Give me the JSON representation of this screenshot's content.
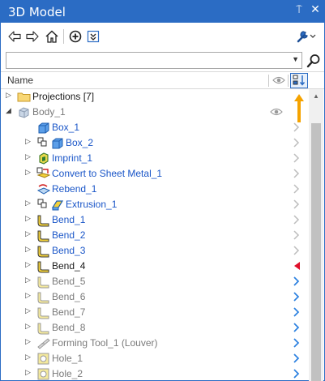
{
  "window": {
    "title": "3D Model",
    "pin_glyph": "⍑",
    "close_glyph": "✕"
  },
  "toolbar": {
    "buttons": [
      "back-arrow-icon",
      "forward-arrow-icon",
      "home-icon",
      "add-view-icon",
      "expand-icon",
      "settings-wrench-icon"
    ]
  },
  "search": {
    "value": "",
    "placeholder": ""
  },
  "header": {
    "name_label": "Name"
  },
  "tree": [
    {
      "label": "Projections [7]",
      "style": "dark",
      "indent": 0,
      "expander": "▷",
      "icon": "folder-icon",
      "mark": "none"
    },
    {
      "label": "Body_1",
      "style": "gray",
      "indent": 0,
      "expander": "◢",
      "icon": "body-icon",
      "mark": "eye"
    },
    {
      "label": "Box_1",
      "style": "blue",
      "indent": 1,
      "expander": "",
      "icon": "box-feature-icon",
      "mark": "chevron-gray"
    },
    {
      "label": "Box_2",
      "style": "blue",
      "indent": 1,
      "expander": "▷",
      "icon": "box-pair-icon",
      "mark": "chevron-gray"
    },
    {
      "label": "Imprint_1",
      "style": "blue",
      "indent": 1,
      "expander": "▷",
      "icon": "imprint-icon",
      "mark": "chevron-gray"
    },
    {
      "label": "Convert to Sheet Metal_1",
      "style": "blue",
      "indent": 1,
      "expander": "▷",
      "icon": "convert-sheet-metal-icon",
      "mark": "chevron-gray"
    },
    {
      "label": "Rebend_1",
      "style": "blue",
      "indent": 1,
      "expander": "",
      "icon": "rebend-icon",
      "mark": "chevron-gray"
    },
    {
      "label": "Extrusion_1",
      "style": "blue",
      "indent": 1,
      "expander": "▷",
      "icon": "extrusion-icon",
      "mark": "chevron-gray"
    },
    {
      "label": "Bend_1",
      "style": "blue",
      "indent": 1,
      "expander": "▷",
      "icon": "bend-icon",
      "mark": "chevron-gray"
    },
    {
      "label": "Bend_2",
      "style": "blue",
      "indent": 1,
      "expander": "▷",
      "icon": "bend-icon",
      "mark": "chevron-gray"
    },
    {
      "label": "Bend_3",
      "style": "blue",
      "indent": 1,
      "expander": "▷",
      "icon": "bend-icon",
      "mark": "chevron-gray"
    },
    {
      "label": "Bend_4",
      "style": "dark",
      "indent": 1,
      "expander": "▷",
      "icon": "bend-icon",
      "mark": "red-marker"
    },
    {
      "label": "Bend_5",
      "style": "gray",
      "indent": 1,
      "expander": "▷",
      "icon": "bend-faded-icon",
      "mark": "chevron-blue"
    },
    {
      "label": "Bend_6",
      "style": "gray",
      "indent": 1,
      "expander": "▷",
      "icon": "bend-faded-icon",
      "mark": "chevron-blue"
    },
    {
      "label": "Bend_7",
      "style": "gray",
      "indent": 1,
      "expander": "▷",
      "icon": "bend-faded-icon",
      "mark": "chevron-blue"
    },
    {
      "label": "Bend_8",
      "style": "gray",
      "indent": 1,
      "expander": "▷",
      "icon": "bend-faded-icon",
      "mark": "chevron-blue"
    },
    {
      "label": "Forming Tool_1 (Louver)",
      "style": "gray",
      "indent": 1,
      "expander": "▷",
      "icon": "forming-tool-icon",
      "mark": "chevron-blue"
    },
    {
      "label": "Hole_1",
      "style": "gray",
      "indent": 1,
      "expander": "▷",
      "icon": "hole-icon",
      "mark": "chevron-blue"
    },
    {
      "label": "Hole_2",
      "style": "gray",
      "indent": 1,
      "expander": "▷",
      "icon": "hole-icon",
      "mark": "chevron-blue"
    }
  ],
  "colors": {
    "accent": "#2b6cc4",
    "link_blue": "#1a56c8",
    "gray_text": "#7a7a7a",
    "marker_red": "#e0102a",
    "annotation_orange": "#f5a300"
  }
}
